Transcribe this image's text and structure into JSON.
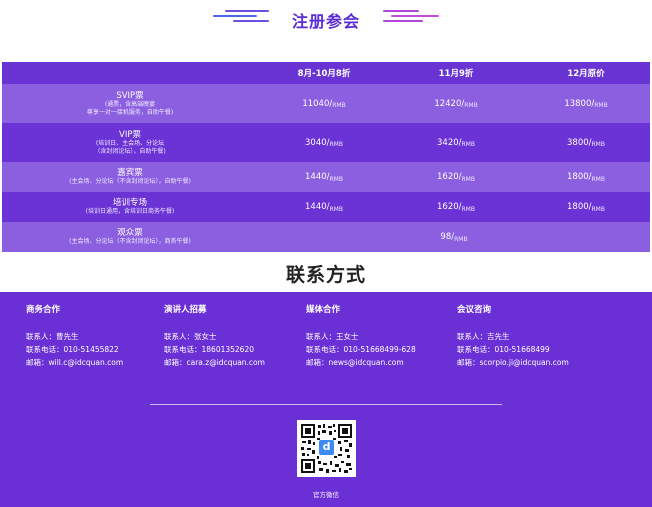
{
  "registration": {
    "title": "注册参会"
  },
  "price_table": {
    "headers": [
      "",
      "8月-10月8折",
      "11月9折",
      "12月原价"
    ],
    "rows": [
      {
        "name": "SVIP票",
        "desc": [
          "(通票，含高端晚宴",
          "尊享一对一接机服务，自助午餐)"
        ],
        "prices": [
          [
            "11040/",
            "RMB"
          ],
          [
            "12420/",
            "RMB"
          ],
          [
            "13800/",
            "RMB"
          ]
        ]
      },
      {
        "name": "VIP票",
        "desc": [
          "(培训日、主会场、分论坛",
          "（含封闭论坛），自助午餐)"
        ],
        "prices": [
          [
            "3040/",
            "RMB"
          ],
          [
            "3420/",
            "RMB"
          ],
          [
            "3800/",
            "RMB"
          ]
        ]
      },
      {
        "name": "嘉宾票",
        "desc": [
          "(主会场、分论坛（不含封闭论坛），自助午餐)"
        ],
        "prices": [
          [
            "1440/",
            "RMB"
          ],
          [
            "1620/",
            "RMB"
          ],
          [
            "1800/",
            "RMB"
          ]
        ]
      },
      {
        "name": "培训专场",
        "desc": [
          "(培训日通用，含培训日商务午餐)"
        ],
        "prices": [
          [
            "1440/",
            "RMB"
          ],
          [
            "1620/",
            "RMB"
          ],
          [
            "1800/",
            "RMB"
          ]
        ]
      },
      {
        "name": "观众票",
        "desc": [
          "(主会场、分论坛（不含封闭论坛），商务午餐)"
        ],
        "price_all": [
          "98/",
          "RMB"
        ]
      }
    ]
  },
  "contact": {
    "title": "联系方式",
    "columns": [
      {
        "title": "商务合作",
        "lines": [
          "联系人：曹先生",
          "联系电话：010-51455822",
          "邮箱：will.c@idcquan.com"
        ]
      },
      {
        "title": "演讲人招募",
        "lines": [
          "联系人：张女士",
          "联系电话：18601352620",
          "邮箱：cara.z@idcquan.com"
        ]
      },
      {
        "title": "媒体合作",
        "lines": [
          "联系人：王女士",
          "联系电话：010-51668499-628",
          "邮箱：news@idcquan.com"
        ]
      },
      {
        "title": "会议咨询",
        "lines": [
          "联系人：吉先生",
          "联系电话：010-51668499",
          "邮箱：scorpio.ji@idcquan.com"
        ]
      }
    ],
    "qr_caption": "官方微信",
    "qr_logo_letter": "d"
  },
  "colors": {
    "accent": "#5a2bd6",
    "table_dark": "#6b33d6",
    "table_light": "#8c5fe0",
    "contact_bg": "#6a2fd5"
  }
}
